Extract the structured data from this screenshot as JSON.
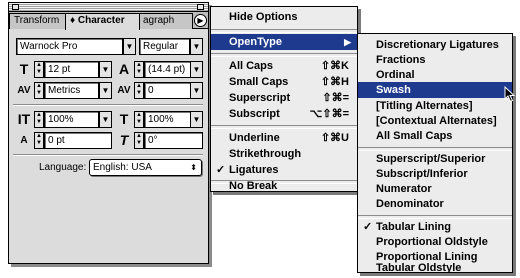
{
  "palette": {
    "tabs": [
      "Transform",
      "Character",
      "agraph"
    ],
    "active_tab": "Character",
    "tab_prefix": "♦",
    "menu_arrow": "▶",
    "font_family": "Warnock Pro",
    "font_style": "Regular",
    "font_size": "12 pt",
    "leading": "(14.4 pt)",
    "kerning": "Metrics",
    "tracking": "0",
    "vertical_scale": "100%",
    "horizontal_scale": "100%",
    "baseline_shift": "0 pt",
    "skew": "0°",
    "language_label": "Language:",
    "language_value": "English: USA",
    "glyphs": {
      "size": "T",
      "leading": "A",
      "kerning": "AV",
      "tracking": "AV",
      "vscale": "IT",
      "hscale": "T",
      "baseline": "A",
      "skew": "T"
    }
  },
  "menu": {
    "items": [
      {
        "label": "Hide Options"
      },
      {
        "label": "OpenType",
        "submenu": true,
        "highlighted": true
      },
      {
        "label": "All Caps",
        "shortcut": "⇧⌘K"
      },
      {
        "label": "Small Caps",
        "shortcut": "⇧⌘H"
      },
      {
        "label": "Superscript",
        "shortcut": "⇧⌘="
      },
      {
        "label": "Subscript",
        "shortcut": "⌥⇧⌘="
      },
      {
        "label": "Underline",
        "shortcut": "⇧⌘U"
      },
      {
        "label": "Strikethrough"
      },
      {
        "label": "Ligatures",
        "checked": true
      },
      {
        "label": "No Break"
      }
    ]
  },
  "submenu": {
    "items": [
      {
        "label": "Discretionary Ligatures"
      },
      {
        "label": "Fractions"
      },
      {
        "label": "Ordinal"
      },
      {
        "label": "Swash",
        "highlighted": true
      },
      {
        "label": "[Titling Alternates]"
      },
      {
        "label": "[Contextual Alternates]"
      },
      {
        "label": "All Small Caps"
      },
      {
        "label": "Superscript/Superior"
      },
      {
        "label": "Subscript/Inferior"
      },
      {
        "label": "Numerator"
      },
      {
        "label": "Denominator"
      },
      {
        "label": "Tabular Lining",
        "checked": true
      },
      {
        "label": "Proportional Oldstyle"
      },
      {
        "label": "Proportional Lining"
      },
      {
        "label": "Tabular Oldstyle"
      }
    ]
  },
  "check_glyph": "✓",
  "dropdown_glyph": "▼",
  "icons": {
    "pointer": "arrow-cursor-icon"
  }
}
